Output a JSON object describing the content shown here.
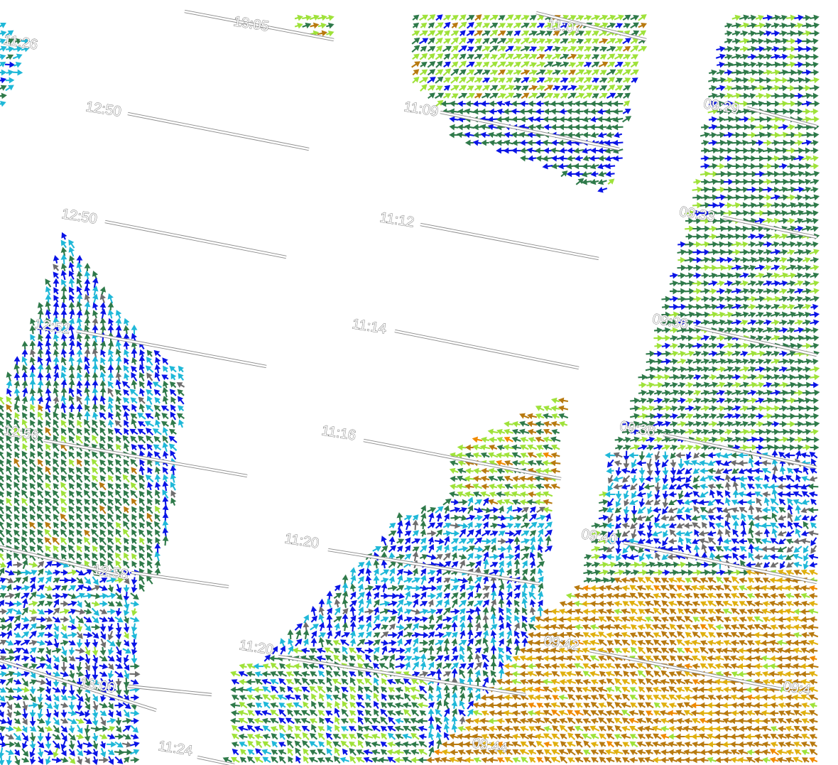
{
  "map": {
    "vector_colors": {
      "deep_blue": "#0a14e6",
      "cyan": "#1fb8d8",
      "dark_green": "#2f7a4a",
      "light_green": "#9fe23a",
      "ochre": "#b87a10",
      "gold": "#e0b010",
      "orange": "#f08a00",
      "gray": "#6e6e6e"
    },
    "labels": [
      {
        "text": "11:26"
      },
      {
        "text": "13:05"
      },
      {
        "text": "12:50"
      },
      {
        "text": "12:50"
      },
      {
        "text": "12:52"
      },
      {
        "text": "12:56"
      },
      {
        "text": "12:58"
      },
      {
        "text": "13:00"
      },
      {
        "text": "11:07"
      },
      {
        "text": "11:09"
      },
      {
        "text": "11:12"
      },
      {
        "text": "11:14"
      },
      {
        "text": "11:16"
      },
      {
        "text": "11:20"
      },
      {
        "text": "11:20"
      },
      {
        "text": "11:24"
      },
      {
        "text": "09:29"
      },
      {
        "text": "09:33"
      },
      {
        "text": "09:36"
      },
      {
        "text": "09:38"
      },
      {
        "text": "09:40"
      },
      {
        "text": "09:42"
      },
      {
        "text": "09:44"
      },
      {
        "text": "09:4"
      }
    ]
  }
}
